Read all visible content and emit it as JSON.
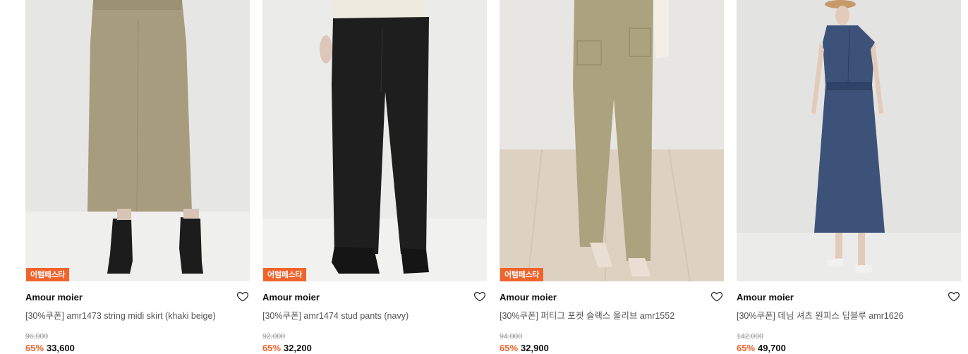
{
  "products": [
    {
      "badge": "어텀페스타",
      "brand": "Amour moier",
      "title": "[30%쿠폰] amr1473 string midi skirt (khaki beige)",
      "original_price": "96,000",
      "discount": "65%",
      "price": "33,600",
      "wishlist_icon": "heart-outline-icon"
    },
    {
      "badge": "어텀페스타",
      "brand": "Amour moier",
      "title": "[30%쿠폰] amr1474 stud pants (navy)",
      "original_price": "92,000",
      "discount": "65%",
      "price": "32,200",
      "wishlist_icon": "heart-outline-icon"
    },
    {
      "badge": "어텀페스타",
      "brand": "Amour moier",
      "title": "[30%쿠폰] 퍼티그 포켓 슬랙스 올리브 amr1552",
      "original_price": "94,000",
      "discount": "65%",
      "price": "32,900",
      "wishlist_icon": "heart-outline-icon"
    },
    {
      "brand": "Amour moier",
      "title": "[30%쿠폰] 데님 셔츠 원피스 딥블루 amr1626",
      "original_price": "142,000",
      "discount": "65%",
      "price": "49,700",
      "wishlist_icon": "heart-outline-icon"
    }
  ],
  "colors": {
    "accent": "#f0632b",
    "text": "#111111",
    "muted": "#999999"
  }
}
